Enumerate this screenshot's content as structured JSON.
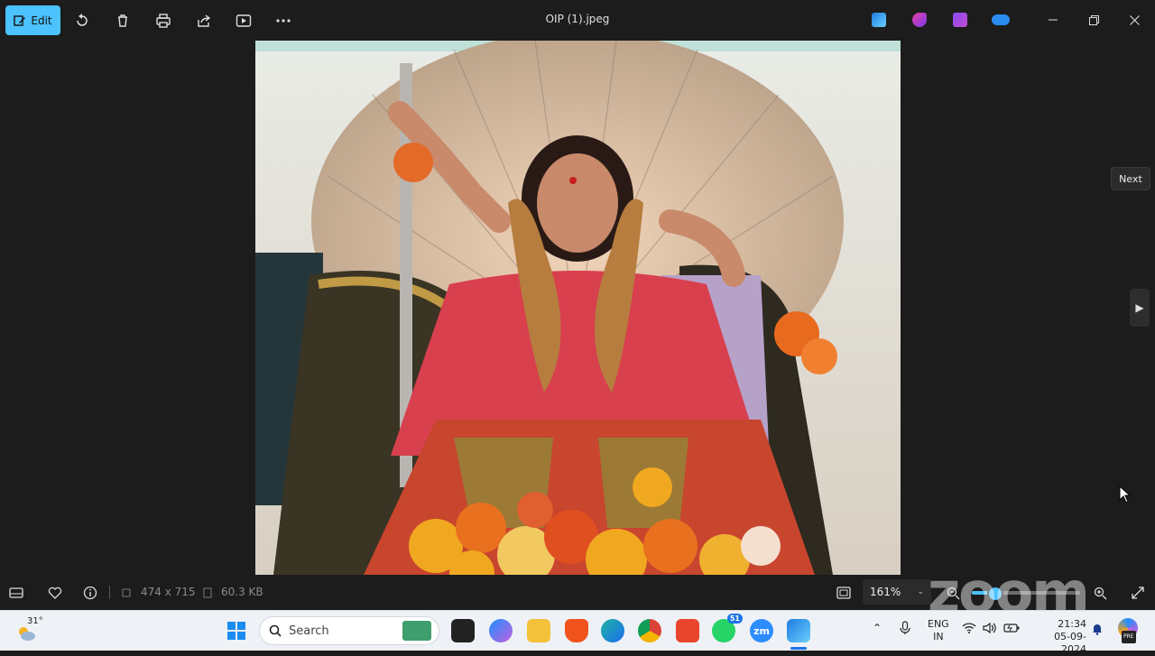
{
  "toolbar": {
    "edit_label": "Edit",
    "title": "OIP (1).jpeg",
    "icons": [
      "rotate-icon",
      "delete-icon",
      "print-icon",
      "share-icon",
      "slideshow-icon",
      "more-icon"
    ]
  },
  "window": {
    "minimize": "minimize-icon",
    "restore": "restore-icon",
    "close": "close-icon"
  },
  "viewer": {
    "next_tooltip": "Next",
    "dimensions": "474 x 715",
    "file_size": "60.3 KB",
    "zoom_level": "161%",
    "zoom_slider_fraction": 0.22
  },
  "overlay": {
    "watermark": "zoom"
  },
  "taskbar": {
    "weather_temp": "31°",
    "search_placeholder": "Search",
    "whatsapp_badge": "51",
    "zoom_app_label": "zm",
    "lang_top": "ENG",
    "lang_bottom": "IN",
    "time": "21:34",
    "date": "05-09-2024",
    "copilot_badge": "PRE"
  },
  "colors": {
    "accent": "#4cc2ff",
    "background": "#1c1c1c",
    "taskbar": "#eef1f6"
  }
}
